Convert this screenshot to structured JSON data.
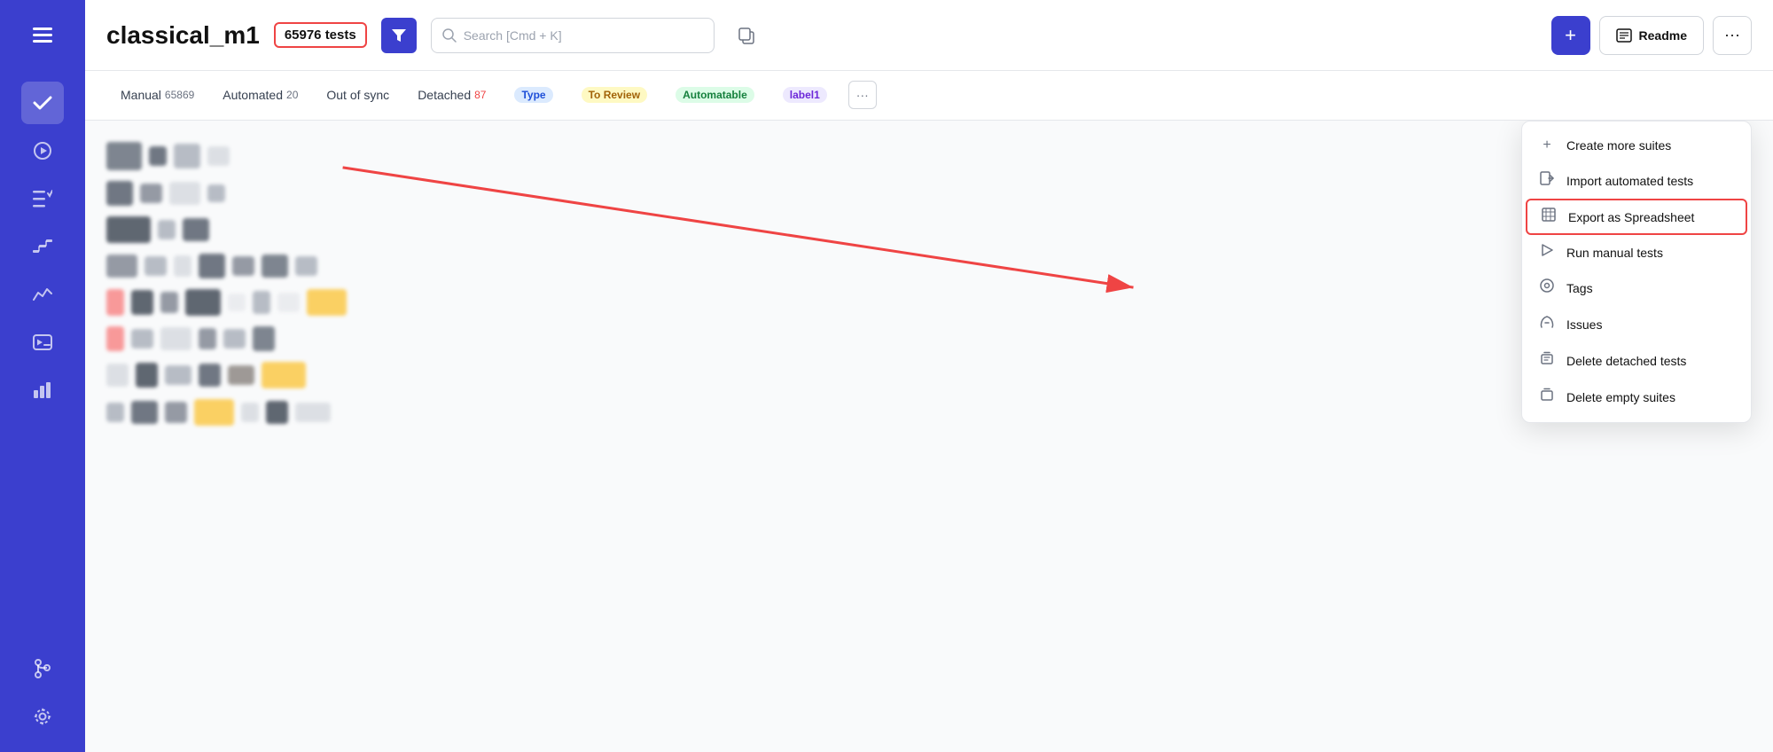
{
  "sidebar": {
    "icons": [
      {
        "name": "menu-icon",
        "symbol": "☰",
        "active": false
      },
      {
        "name": "check-icon",
        "symbol": "✓",
        "active": true
      },
      {
        "name": "play-icon",
        "symbol": "▶",
        "active": false
      },
      {
        "name": "list-check-icon",
        "symbol": "≡✓",
        "active": false
      },
      {
        "name": "steps-icon",
        "symbol": "∿",
        "active": false
      },
      {
        "name": "analytics-icon",
        "symbol": "∿",
        "active": false
      },
      {
        "name": "terminal-icon",
        "symbol": "⊞",
        "active": false
      },
      {
        "name": "chart-icon",
        "symbol": "▦",
        "active": false
      },
      {
        "name": "branch-icon",
        "symbol": "⎇",
        "active": false
      },
      {
        "name": "settings-icon",
        "symbol": "⚙",
        "active": false
      }
    ]
  },
  "header": {
    "project_title": "classical_m1",
    "test_count": "65976 tests",
    "search_placeholder": "Search [Cmd + K]",
    "btn_add_label": "+",
    "btn_readme_label": "Readme",
    "btn_more_label": "···"
  },
  "tabs": [
    {
      "label": "Manual",
      "count": "65869",
      "count_type": "normal"
    },
    {
      "label": "Automated",
      "count": "20",
      "count_type": "normal"
    },
    {
      "label": "Out of sync",
      "count": "",
      "count_type": "none"
    },
    {
      "label": "Detached",
      "count": "87",
      "count_type": "red"
    },
    {
      "label": "Type",
      "count": "",
      "count_type": "badge-blue"
    },
    {
      "label": "To Review",
      "count": "",
      "count_type": "badge-yellow"
    },
    {
      "label": "Automatable",
      "count": "",
      "count_type": "badge-green"
    },
    {
      "label": "label1",
      "count": "",
      "count_type": "badge-purple"
    },
    {
      "label": "···",
      "count": "",
      "count_type": "more"
    }
  ],
  "dropdown": {
    "items": [
      {
        "icon": "+",
        "label": "Create more suites",
        "highlighted": false,
        "name": "create-suites-item"
      },
      {
        "icon": "↵",
        "label": "Import automated tests",
        "highlighted": false,
        "name": "import-tests-item"
      },
      {
        "icon": "⊞",
        "label": "Export as Spreadsheet",
        "highlighted": true,
        "name": "export-spreadsheet-item"
      },
      {
        "icon": "▶",
        "label": "Run manual tests",
        "highlighted": false,
        "name": "run-manual-tests-item"
      },
      {
        "icon": "@",
        "label": "Tags",
        "highlighted": false,
        "name": "tags-item"
      },
      {
        "icon": "⊘",
        "label": "Issues",
        "highlighted": false,
        "name": "issues-item"
      },
      {
        "icon": "⊠",
        "label": "Delete detached tests",
        "highlighted": false,
        "name": "delete-detached-item"
      },
      {
        "icon": "⊡",
        "label": "Delete empty suites",
        "highlighted": false,
        "name": "delete-empty-item"
      }
    ]
  },
  "content_blocks": [
    {
      "colors": [
        "#4b5563",
        "#374151",
        "#9ca3af",
        "#d1d5db"
      ],
      "widths": [
        40,
        20,
        30,
        25
      ]
    },
    {
      "colors": [
        "#374151",
        "#6b7280",
        "#d1d5db",
        "#9ca3af"
      ],
      "widths": [
        30,
        25,
        35,
        20
      ]
    },
    {
      "colors": [
        "#1f2937",
        "#9ca3af",
        "#374151"
      ],
      "widths": [
        50,
        20,
        30
      ]
    },
    {
      "colors": [
        "#6b7280",
        "#9ca3af",
        "#d1d5db",
        "#374151",
        "#6b7280",
        "#4b5563",
        "#9ca3af"
      ],
      "widths": [
        35,
        25,
        20,
        30,
        25,
        30,
        25
      ]
    },
    {
      "colors": [
        "#f87171",
        "#1f2937",
        "#6b7280",
        "#1f2937",
        "#e5e7eb",
        "#9ca3af",
        "#e5e7eb"
      ],
      "widths": [
        20,
        25,
        20,
        40,
        20,
        20,
        25
      ]
    },
    {
      "colors": [
        "#f87171",
        "#9ca3af",
        "#d1d5db",
        "#6b7280",
        "#9ca3af",
        "#4b5563"
      ],
      "widths": [
        20,
        25,
        35,
        20,
        25,
        25
      ]
    },
    {
      "colors": [
        "#d1d5db",
        "#1f2937",
        "#9ca3af",
        "#374151",
        "#78716c",
        "#fbbf24"
      ],
      "widths": [
        25,
        25,
        30,
        25,
        30,
        50
      ]
    },
    {
      "colors": [
        "#9ca3af",
        "#374151",
        "#6b7280",
        "#fbbf24",
        "#d1d5db",
        "#1f2937",
        "#d1d5db"
      ],
      "widths": [
        20,
        30,
        25,
        45,
        20,
        25,
        40
      ]
    }
  ]
}
